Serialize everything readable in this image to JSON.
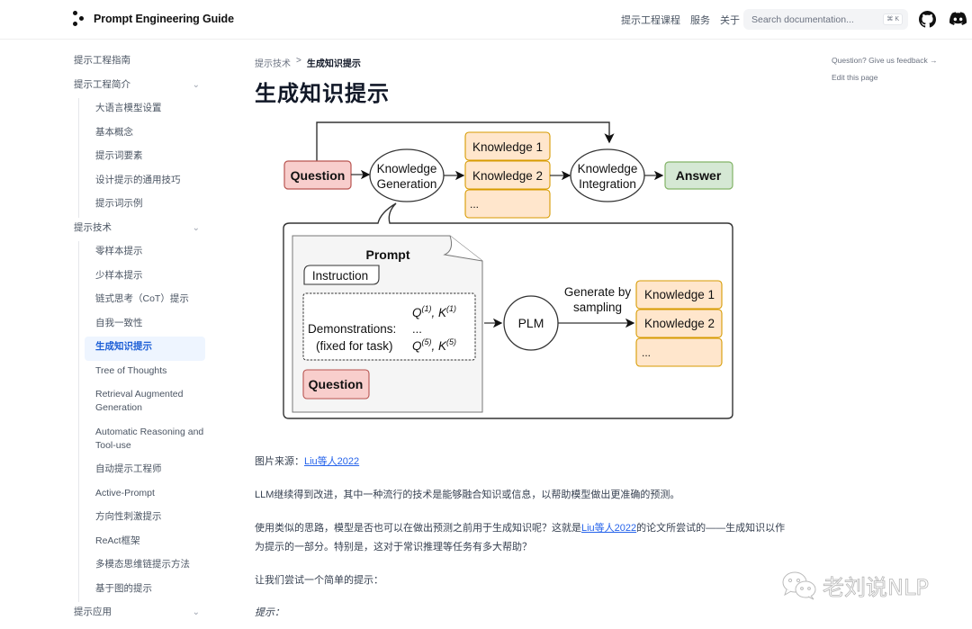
{
  "header": {
    "logo_text": "Prompt Engineering Guide",
    "nav": [
      "提示工程课程",
      "服务",
      "关于"
    ],
    "search_placeholder": "Search documentation...",
    "search_shortcut": "⌘ K",
    "icons": [
      "github-icon",
      "discord-icon"
    ]
  },
  "sidebar": {
    "items": [
      {
        "label": "提示工程指南"
      },
      {
        "label": "提示工程简介",
        "expandable": true
      },
      {
        "label": "提示技术",
        "expandable": true
      },
      {
        "label": "提示应用",
        "expandable": true
      }
    ],
    "intro_children": [
      "大语言模型设置",
      "基本概念",
      "提示词要素",
      "设计提示的通用技巧",
      "提示词示例"
    ],
    "technique_children": [
      "零样本提示",
      "少样本提示",
      "链式思考（CoT）提示",
      "自我一致性",
      "生成知识提示",
      "Tree of Thoughts",
      "Retrieval Augmented Generation",
      "Automatic Reasoning and Tool-use",
      "自动提示工程师",
      "Active-Prompt",
      "方向性刺激提示",
      "ReAct框架",
      "多模态思维链提示方法",
      "基于图的提示"
    ],
    "active": "生成知识提示",
    "chevron": "⌄"
  },
  "breadcrumb": {
    "parent": "提示技术",
    "separator": ">",
    "current": "生成知识提示"
  },
  "page_title": "生成知识提示",
  "toc": {
    "feedback": "Question? Give us feedback →",
    "edit": "Edit this page"
  },
  "diagram": {
    "question": "Question",
    "knowledge_generation": [
      "Knowledge",
      "Generation"
    ],
    "knowledge_items": [
      "Knowledge 1",
      "Knowledge 2",
      "..."
    ],
    "knowledge_integration": [
      "Knowledge",
      "Integration"
    ],
    "answer": "Answer",
    "prompt_title": "Prompt",
    "instruction": "Instruction",
    "demonstrations": [
      "Demonstrations:",
      "(fixed for task)"
    ],
    "demo_q1": "Q",
    "demo_sup1": "(1)",
    "demo_k1": "K",
    "demo_ellipsis": "...",
    "demo_sup5": "(5)",
    "prompt_question": "Question",
    "plm": "PLM",
    "generate_label": [
      "Generate by",
      "sampling"
    ],
    "sample_items": [
      "Knowledge 1",
      "Knowledge 2",
      "..."
    ],
    "colors": {
      "question_fill": "#f8cecc",
      "question_stroke": "#b85450",
      "knowledge_fill": "#ffe6cc",
      "knowledge_stroke": "#d79b00",
      "answer_fill": "#d5e8d4",
      "answer_stroke": "#82b366",
      "prompt_fill": "#f5f5f5"
    }
  },
  "content": {
    "source_label": "图片来源：",
    "source_link": "Liu等人2022",
    "p1": "LLM继续得到改进，其中一种流行的技术是能够融合知识或信息，以帮助模型做出更准确的预测。",
    "p2_before": "使用类似的思路，模型是否也可以在做出预测之前用于生成知识呢？这就是",
    "p2_link": "Liu等人2022",
    "p2_after": "的论文所尝试的——生成知识以作为提示的一部分。特别是，这对于常识推理等任务有多大帮助？",
    "p3": "让我们尝试一个简单的提示：",
    "p4": "提示："
  },
  "watermark": {
    "text": "老刘说NLP",
    "icon": "wechat-icon"
  },
  "colors": {
    "accent": "#1d5fd6",
    "active_bg": "#eef5ff",
    "link": "#2563eb"
  }
}
